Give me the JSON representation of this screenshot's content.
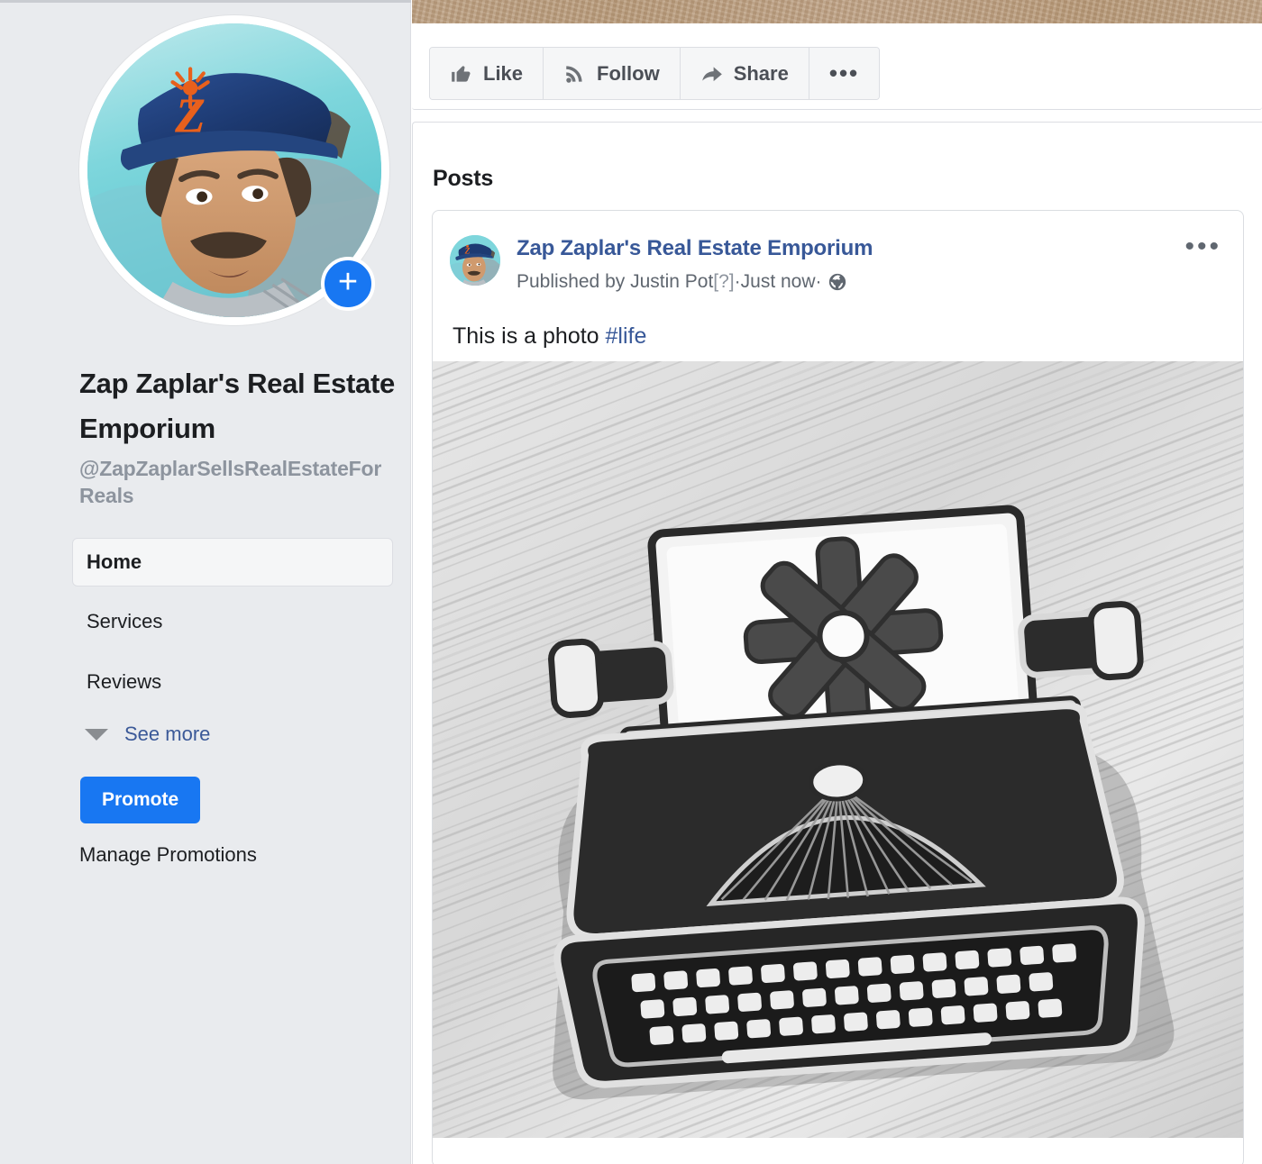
{
  "sidebar": {
    "avatar": {
      "name": "page-profile-photo",
      "alt": "Man with mustache wearing navy baseball cap with orange Z logo",
      "cap_color": "#1f3f7a",
      "logo_color": "#e8601c",
      "sky_color": "#8fd8d8"
    },
    "add_badge_label": "+",
    "page_title": "Zap Zaplar's Real Estate Emporium",
    "page_handle": "@ZapZaplarSellsRealEstateForReals",
    "nav_items": [
      {
        "label": "Home",
        "active": true
      },
      {
        "label": "Services",
        "active": false
      },
      {
        "label": "Reviews",
        "active": false
      }
    ],
    "see_more_label": "See more",
    "promote_label": "Promote",
    "manage_promotions_label": "Manage Promotions"
  },
  "cover": {
    "name": "cover-photo",
    "description": "Tan cardboard texture cover photo",
    "color": "#bda183"
  },
  "action_bar": {
    "like_label": "Like",
    "follow_label": "Follow",
    "share_label": "Share",
    "more_label": "•••"
  },
  "posts_section": {
    "heading": "Posts",
    "post": {
      "author": "Zap Zaplar's Real Estate Emporium",
      "meta_published_by": "Published by Justin Pot ",
      "meta_help": "[?]",
      "meta_separator_1": " · ",
      "meta_time": "Just now",
      "meta_separator_2": " · ",
      "privacy_icon": "globe-icon",
      "more_label": "•••",
      "text": "This is a photo ",
      "hashtag": "#life",
      "photo": {
        "name": "post-photo",
        "description": "Black and white photo of a typewriter enamel pin with an asterisk on the paper, on a wooden surface"
      }
    }
  },
  "colors": {
    "brand_blue": "#1877f2",
    "link_blue": "#385898",
    "sidebar_bg": "#e9ebee",
    "text_primary": "#1c1e21",
    "text_secondary": "#606770",
    "muted": "#8d949e",
    "border": "#dcdee3"
  }
}
